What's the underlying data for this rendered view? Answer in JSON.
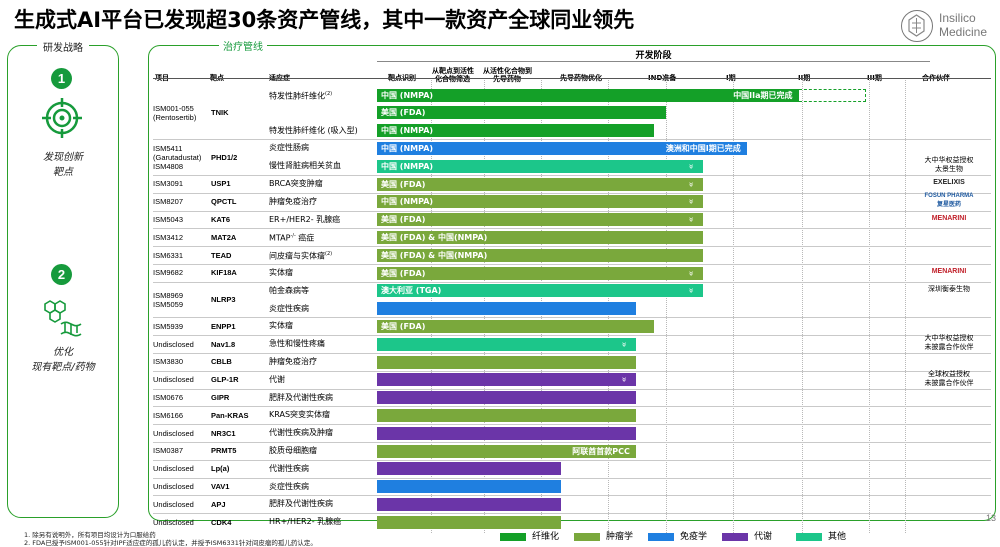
{
  "title": "生成式AI平台已发现超30条资产管线，其中一款资产全球同业领先",
  "logo": {
    "line1": "Insilico",
    "line2": "Medicine"
  },
  "page_number": "13",
  "left_panel": {
    "title": "研发战略",
    "steps": [
      {
        "number": "1",
        "line1": "发现创新",
        "line2": "靶点"
      },
      {
        "number": "2",
        "line1": "优化",
        "line2": "现有靶点/药物"
      }
    ]
  },
  "main_panel": {
    "title": "治疗管线",
    "dev_stage_header": "开发阶段",
    "columns": {
      "project": "项目",
      "target": "靶点",
      "indication": "适应症",
      "stage1": "靶点识别",
      "stage2_line1": "从靶点到活性",
      "stage2_line2": "化合物筛选",
      "stage3_line1": "从活性化合物到",
      "stage3_line2": "先导药物",
      "stage4": "先导药物优化",
      "stage5": "IND准备",
      "stage6": "I期",
      "stage7": "II期",
      "stage8": "III期",
      "partner": "合作伙伴"
    }
  },
  "projects": [
    {
      "ids": [
        "ISM001-055",
        "(Rentosertib)"
      ],
      "target": "TNIK",
      "rows": 3
    },
    {
      "ids": [
        "ISM5411",
        "(Garutadustat)",
        "ISM4808"
      ],
      "target": "PHD1/2",
      "rows": 2
    },
    {
      "ids": [
        "ISM3091"
      ],
      "target": "USP1",
      "rows": 1
    },
    {
      "ids": [
        "ISM8207"
      ],
      "target": "QPCTL",
      "rows": 1
    },
    {
      "ids": [
        "ISM5043"
      ],
      "target": "KAT6",
      "rows": 1
    },
    {
      "ids": [
        "ISM3412"
      ],
      "target": "MAT2A",
      "rows": 1
    },
    {
      "ids": [
        "ISM6331"
      ],
      "target": "TEAD",
      "rows": 1
    },
    {
      "ids": [
        "ISM9682"
      ],
      "target": "KIF18A",
      "rows": 1
    },
    {
      "ids": [
        "ISM8969",
        "ISM5059"
      ],
      "target": "NLRP3",
      "rows": 2
    },
    {
      "ids": [
        "ISM5939"
      ],
      "target": "ENPP1",
      "rows": 1
    },
    {
      "ids": [
        "Undisclosed"
      ],
      "target": "Nav1.8",
      "rows": 1
    },
    {
      "ids": [
        "ISM3830"
      ],
      "target": "CBLB",
      "rows": 1
    },
    {
      "ids": [
        "Undisclosed"
      ],
      "target": "GLP-1R",
      "rows": 1
    },
    {
      "ids": [
        "ISM0676"
      ],
      "target": "GIPR",
      "rows": 1
    },
    {
      "ids": [
        "ISM6166"
      ],
      "target": "Pan-KRAS",
      "rows": 1
    },
    {
      "ids": [
        "Undisclosed"
      ],
      "target": "NR3C1",
      "rows": 1
    },
    {
      "ids": [
        "ISM0387"
      ],
      "target": "PRMT5",
      "rows": 1
    },
    {
      "ids": [
        "Undisclosed"
      ],
      "target": "Lp(a)",
      "rows": 1
    },
    {
      "ids": [
        "Undisclosed"
      ],
      "target": "VAV1",
      "rows": 1
    },
    {
      "ids": [
        "Undisclosed"
      ],
      "target": "APJ",
      "rows": 1
    },
    {
      "ids": [
        "Undisclosed"
      ],
      "target": "CDK4",
      "rows": 1
    }
  ],
  "rows": [
    {
      "indication": "特发性肺纤维化",
      "sup": "(2)",
      "category": "fibrosis",
      "stage_end": 6.95,
      "label": "中国 (NMPA)",
      "right_label": "中国IIa期已完成",
      "extension_end": 7.95
    },
    {
      "indication": "",
      "sup": "",
      "category": "fibrosis",
      "stage_end": 5.0,
      "label": "美国 (FDA)"
    },
    {
      "indication": "特发性肺纤维化 (吸入型)",
      "sup": "",
      "category": "fibrosis",
      "stage_end": 4.8,
      "label": "中国 (NMPA)"
    },
    {
      "indication": "炎症性肠病",
      "sup": "",
      "category": "immunology",
      "stage_end": 6.2,
      "label": "中国 (NMPA)",
      "right_label": "澳洲和中国I期已完成"
    },
    {
      "indication": "慢性肾脏病相关贫血",
      "sup": "",
      "category": "other",
      "stage_end": 5.55,
      "label": "中国 (NMPA)",
      "chevron": true
    },
    {
      "indication": "BRCA突变肿瘤",
      "sup": "",
      "category": "oncology",
      "stage_end": 5.55,
      "label": "美国 (FDA)",
      "chevron": true
    },
    {
      "indication": "肿瘤免疫治疗",
      "sup": "",
      "category": "oncology",
      "stage_end": 5.55,
      "label": "中国 (NMPA)",
      "chevron": true
    },
    {
      "indication": "ER+/HER2- 乳腺癌",
      "sup": "",
      "category": "oncology",
      "stage_end": 5.55,
      "label": "美国 (FDA)",
      "chevron": true
    },
    {
      "indication": "MTAP",
      "sup": "-/-",
      "indication_suffix": " 癌症",
      "category": "oncology",
      "stage_end": 5.55,
      "label": "美国 (FDA) & 中国(NMPA)"
    },
    {
      "indication": "间皮瘤与实体瘤",
      "sup": "(2)",
      "category": "oncology",
      "stage_end": 5.55,
      "label": "美国 (FDA) & 中国(NMPA)"
    },
    {
      "indication": "实体瘤",
      "sup": "",
      "category": "oncology",
      "stage_end": 5.55,
      "label": "美国 (FDA)",
      "chevron": true
    },
    {
      "indication": "帕金森病等",
      "sup": "",
      "category": "other",
      "stage_end": 5.55,
      "label": "澳大利亚 (TGA)",
      "chevron": true
    },
    {
      "indication": "炎症性疾病",
      "sup": "",
      "category": "immunology",
      "stage_end": 4.48,
      "label": ""
    },
    {
      "indication": "实体瘤",
      "sup": "",
      "category": "oncology",
      "stage_end": 4.8,
      "label": "美国 (FDA)"
    },
    {
      "indication": "急性和慢性疼痛",
      "sup": "",
      "category": "other",
      "stage_end": 4.48,
      "label": "",
      "chevron": true
    },
    {
      "indication": "肿瘤免疫治疗",
      "sup": "",
      "category": "oncology",
      "stage_end": 4.48,
      "label": ""
    },
    {
      "indication": "代谢",
      "sup": "",
      "category": "metabolic",
      "stage_end": 4.48,
      "label": "",
      "chevron": true
    },
    {
      "indication": "肥胖及代谢性疾病",
      "sup": "",
      "category": "metabolic",
      "stage_end": 4.48,
      "label": ""
    },
    {
      "indication": "KRAS突变实体瘤",
      "sup": "",
      "category": "oncology",
      "stage_end": 4.48,
      "label": ""
    },
    {
      "indication": "代谢性疾病及肿瘤",
      "sup": "",
      "category": "metabolic",
      "stage_end": 4.48,
      "label": ""
    },
    {
      "indication": "胶质母细胞瘤",
      "sup": "",
      "category": "oncology",
      "stage_end": 4.48,
      "label": "",
      "right_label": "阿联酋首款PCC"
    },
    {
      "indication": "代谢性疾病",
      "sup": "",
      "category": "metabolic",
      "stage_end": 3.3,
      "label": ""
    },
    {
      "indication": "炎症性疾病",
      "sup": "",
      "category": "immunology",
      "stage_end": 3.3,
      "label": ""
    },
    {
      "indication": "肥胖及代谢性疾病",
      "sup": "",
      "category": "metabolic",
      "stage_end": 3.3,
      "label": ""
    },
    {
      "indication": "HR+/HER2- 乳腺癌",
      "sup": "",
      "category": "oncology",
      "stage_end": 3.3,
      "label": ""
    }
  ],
  "partners": [
    {
      "row": 4,
      "text": "大中华权益授权太景生物",
      "lines": [
        "大中华权益授权",
        "太景生物"
      ]
    },
    {
      "row": 5,
      "text": "EXELIXIS",
      "lines": [
        "EXELIXIS"
      ],
      "logo": true
    },
    {
      "row": 6,
      "text": "FOSUN PHARMA 复星医药",
      "lines": [
        "FOSUN PHARMA",
        "复星医药"
      ],
      "logo": true
    },
    {
      "row": 7,
      "text": "MENARINI",
      "lines": [
        "MENARINI"
      ],
      "logo": true
    },
    {
      "row": 10,
      "text": "MENARINI",
      "lines": [
        "MENARINI"
      ],
      "logo": true
    },
    {
      "row": 11,
      "text": "深圳衡泰生物",
      "lines": [
        "深圳衡泰生物"
      ]
    },
    {
      "row": 14,
      "text": "大中华权益授权未披露合作伙伴",
      "lines": [
        "大中华权益授权",
        "未披露合作伙伴"
      ]
    },
    {
      "row": 16,
      "text": "全球权益授权未披露合作伙伴",
      "lines": [
        "全球权益授权",
        "未披露合作伙伴"
      ]
    }
  ],
  "legend": [
    {
      "label": "纤维化",
      "category": "fibrosis"
    },
    {
      "label": "肿瘤学",
      "category": "oncology"
    },
    {
      "label": "免疫学",
      "category": "immunology"
    },
    {
      "label": "代谢",
      "category": "metabolic"
    },
    {
      "label": "其他",
      "category": "other"
    }
  ],
  "colors": {
    "fibrosis": "#14a028",
    "oncology": "#7aa83c",
    "immunology": "#1f7fe0",
    "metabolic": "#6b35a8",
    "other": "#1cc68a",
    "border": "#2aa02a",
    "step_circle": "#169a3c"
  },
  "footnotes": [
    "1. 除另有说明外，所有项目均设计为口服给药",
    "2. FDA已授予ISM001-055针对IPF适应症的孤儿药认定，并授予ISM6331针对间皮瘤的孤儿药认定。"
  ]
}
